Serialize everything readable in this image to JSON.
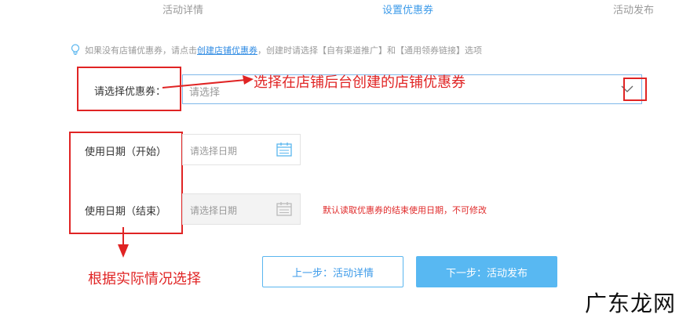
{
  "steps": [
    "活动详情",
    "设置优惠券",
    "活动发布"
  ],
  "tip": {
    "text_before": "如果没有店铺优惠券，请点击",
    "link": "创建店铺优惠券",
    "text_after": "，创建时请选择【自有渠道推广】和【通用领券链接】选项"
  },
  "coupon": {
    "label": "请选择优惠券：",
    "placeholder": "请选择"
  },
  "start_date": {
    "label": "使用日期（开始）",
    "placeholder": "请选择日期"
  },
  "end_date": {
    "label": "使用日期（结束）",
    "placeholder": "请选择日期",
    "note": "默认读取优惠券的结束使用日期，不可修改"
  },
  "annotations": {
    "coupon_hint": "选择在店铺后台创建的店铺优惠券",
    "date_hint": "根据实际情况选择"
  },
  "buttons": {
    "prev": "上一步：活动详情",
    "next": "下一步：活动发布"
  },
  "watermark": "广东龙网",
  "colors": {
    "accent": "#3d9be9",
    "annotation_red": "#e02424",
    "note_red": "#e02b2b"
  }
}
